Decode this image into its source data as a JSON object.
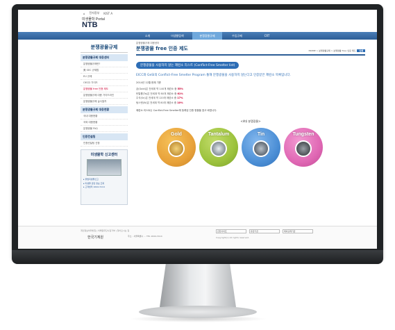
{
  "utility": {
    "home": "⌂",
    "items": [
      "전자정부",
      "KIST A"
    ]
  },
  "brand": {
    "small": "미생물학 Portal",
    "big": "NTB"
  },
  "nav": {
    "items": [
      "소개",
      "미생물탐색",
      "분쟁광물규제",
      "수입규제",
      "CRT"
    ],
    "active_index": 2
  },
  "sidebar": {
    "title": "분쟁광물규제",
    "groups": [
      {
        "label": "분쟁광물규제 대응센터",
        "items": [
          "분쟁광물규제란?",
          "美 SEC 규제법",
          "EU 규제",
          "OECD 가이드",
          "분쟁광물 free 인증 제도",
          "분쟁광물규제 대응 가이드라인",
          "분쟁광물규제 실사절차"
        ]
      },
      {
        "label": "분쟁광물규제 대응현황",
        "items": [
          "국내 대응현황",
          "국외 대응현황",
          "분쟁광물 FAQ"
        ]
      },
      {
        "label": "인증컨설팅",
        "items": [
          "인증컨설팅 신청"
        ]
      }
    ],
    "current": "분쟁광물 free 인증 제도",
    "report": {
      "title": "미생물학 신고센터",
      "lines": [
        "▸ 불법미생물신고",
        "▸ 미생물 관련 정보 조회",
        "▸ 고객센터 1644-3114"
      ]
    }
  },
  "main": {
    "pretitle": "분쟁광물규제 대응센터",
    "title": "분쟁광물 free 인증 제도",
    "breadcrumb": "HOME > 분쟁광물규제 > 분쟁광물 free 인증 제도",
    "print_label": "인쇄",
    "section_header": "분쟁광물을 사용하지 않는 제련소 리스트 (Conflict-Free Smelter list)",
    "lead": "EICC와 GeSI의 Conflict-Free Smelter Program 통해 분쟁광물을 사용하지 않는다고 인증받은 제련소 목록입니다.",
    "date_line": "2014년 12월 현재 기준",
    "stats": [
      {
        "text": "금(Gold)은 전세계 약 140개 제련소 중",
        "value": "55%"
      },
      {
        "text": "탄탈룸(Ta)은 전세계 약 80개 제련소 중",
        "value": "61%"
      },
      {
        "text": "주석(Sn)은 전세계 약 120개 제련소 중",
        "value": "17%"
      },
      {
        "text": "텅스텐(W)은 전세계 약 80개 제련소 중",
        "value": "10%"
      }
    ],
    "note": "제련소 리스트는 Conflict-Free Smelter에 등록된 인증 현황을 참고 바랍니다.",
    "caption": "<4대 분쟁광물>",
    "minerals": [
      {
        "name": "Gold",
        "color": "#e8a23a"
      },
      {
        "name": "Tantalum",
        "color": "#9cc23c"
      },
      {
        "name": "Tin",
        "color": "#4c8fd6"
      },
      {
        "name": "Tungsten",
        "color": "#e068b4"
      }
    ]
  },
  "footer": {
    "links": "개인정보처리방침 | 이메일무단수집거부 | 찾아오시는 길",
    "logo": "한국기계원",
    "addr": "주소 : 서울특별시 ... TEL 1644-3114",
    "selects": [
      "관련사이트",
      "유관기관",
      "해외규제기관"
    ],
    "copy": "Copyright(c) All rights reserved."
  }
}
